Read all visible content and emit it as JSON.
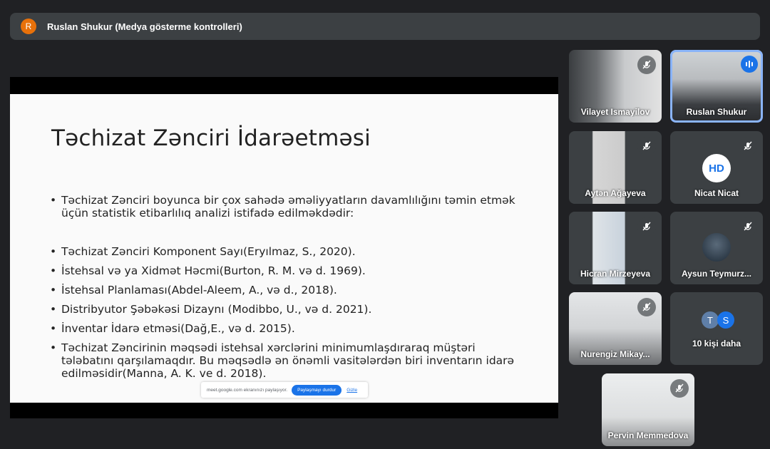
{
  "header": {
    "avatar_letter": "R",
    "title": "Ruslan Shukur (Medya gösterme kontrolleri)"
  },
  "slide": {
    "title": "Təchizat Zənciri İdarəetməsi",
    "bullets": [
      "Təchizat Zənciri boyunca bir çox sahədə əməliyyatların davamlılığını təmin etmək üçün statistik etibarlılıq analizi istifadə edilməkdədir:",
      "Təchizat Zənciri Komponent Sayı(Eryılmaz, S., 2020).",
      "İstehsal və ya Xidmət Həcmi(Burton, R. M. və d. 1969).",
      "İstehsal Planlaması(Abdel-Aleem, A., və d., 2018).",
      "Distribyutor Şəbəkəsi Dizaynı (Modibbo, U., və d. 2021).",
      "İnventar İdarə etməsi(Dağ,E., və d. 2015).",
      "Təchizat Zəncirinin məqsədi istehsal xərclərini minimumlaşdıraraq müştəri tələbatını qarşılamaqdır. Bu məqsədlə ən önəmli vasitələrdən biri inventarın idarə edilməsidir(Manna, A. K. ve d. 2018)."
    ]
  },
  "share_bar": {
    "message": "meet.google.com ekranınızı paylaşıyor.",
    "stop_label": "Paylaşmayı durdur",
    "hide_label": "Gizle"
  },
  "participants": [
    {
      "name": "Vilayet Ismayilov",
      "mic": "muted"
    },
    {
      "name": "Ruslan Shukur",
      "mic": "speaking"
    },
    {
      "name": "Aytən Ağayeva",
      "mic": "muted"
    },
    {
      "name": "Nicat Nicat",
      "mic": "muted",
      "avatar_text": "HD"
    },
    {
      "name": "Hicran Mirzeyeva",
      "mic": "muted"
    },
    {
      "name": "Aysun Teymurz...",
      "mic": "muted"
    },
    {
      "name": "Nurengiz Mikay...",
      "mic": "muted"
    },
    {
      "name": "10 kişi daha",
      "avatars": [
        "T",
        "S"
      ]
    },
    {
      "name": "Pervin Memmedova",
      "mic": "muted"
    }
  ],
  "colors": {
    "background": "#202124",
    "tile": "#3c4043",
    "accent": "#1a73e8",
    "avatar_orange": "#e8710a"
  },
  "icons": {
    "muted": "mic-off-icon",
    "speaking": "audio-levels-icon"
  }
}
